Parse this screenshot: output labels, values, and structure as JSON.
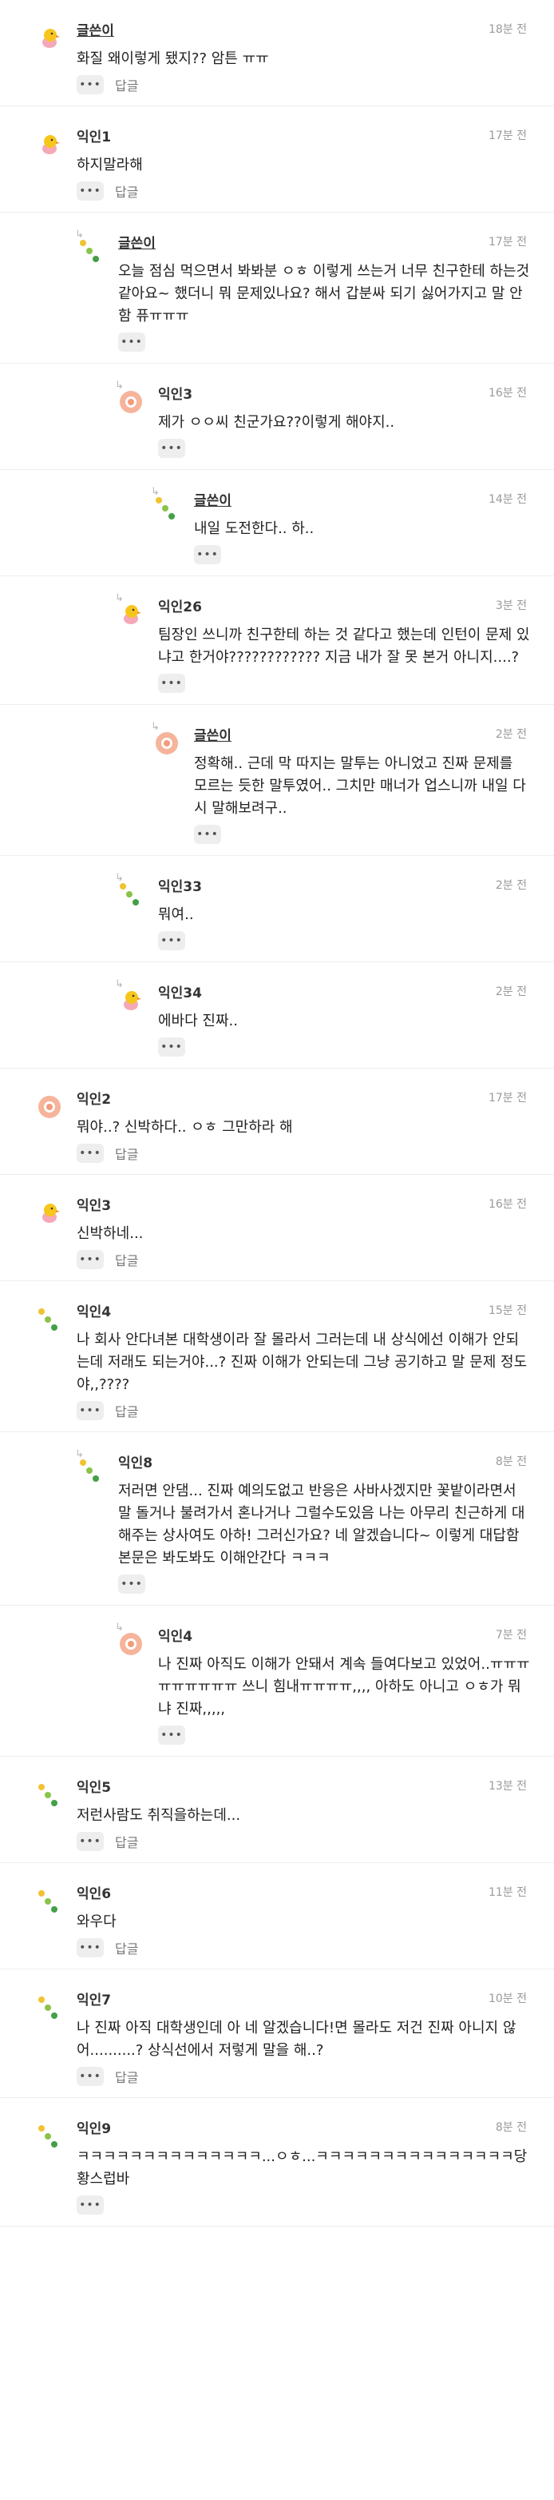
{
  "ui": {
    "more_label": "•••",
    "reply_label": "답글"
  },
  "comments": [
    {
      "author": "글쓴이",
      "writer": true,
      "time": "18분 전",
      "avatar": "chick",
      "depth": 0,
      "text": "화질 왜이렇게 됐지?? 암튼 ㅠㅠ",
      "show_reply": true
    },
    {
      "author": "익인1",
      "time": "17분 전",
      "avatar": "chick",
      "depth": 0,
      "text": "하지말라해",
      "show_reply": true
    },
    {
      "author": "글쓴이",
      "writer": true,
      "time": "17분 전",
      "avatar": "dots",
      "depth": 1,
      "text": "오늘 점심 먹으면서 봐봐분 ㅇㅎ 이렇게 쓰는거 너무 친구한테 하는것 같아요~ 했더니 뭐 문제있나요? 해서 갑분싸 되기 싫어가지고 말 안함 퓨ㅠㅠㅠ",
      "show_reply": false
    },
    {
      "author": "익인3",
      "time": "16분 전",
      "avatar": "ring",
      "depth": 2,
      "text": "제가 ㅇㅇ씨 친군가요??이렇게 해야지..",
      "show_reply": false
    },
    {
      "author": "글쓴이",
      "writer": true,
      "time": "14분 전",
      "avatar": "dots",
      "depth": 3,
      "text": "내일 도전한다.. 하..",
      "show_reply": false
    },
    {
      "author": "익인26",
      "time": "3분 전",
      "avatar": "chick",
      "depth": 2,
      "text": "팀장인 쓰니까 친구한테 하는 것 같다고 했는데 인턴이 문제 있냐고 한거야???????????? 지금 내가 잘 못 본거 아니지....?",
      "show_reply": false
    },
    {
      "author": "글쓴이",
      "writer": true,
      "time": "2분 전",
      "avatar": "ring",
      "depth": 3,
      "text": "정확해.. 근데 막 따지는 말투는 아니었고 진짜 문제를 모르는 듯한 말투였어.. 그치만 매너가 업스니까 내일 다시 말해보려구..",
      "show_reply": false
    },
    {
      "author": "익인33",
      "time": "2분 전",
      "avatar": "dots",
      "depth": 2,
      "text": "뭐여..",
      "show_reply": false
    },
    {
      "author": "익인34",
      "time": "2분 전",
      "avatar": "chick",
      "depth": 2,
      "text": "에바다 진짜..",
      "show_reply": false
    },
    {
      "author": "익인2",
      "time": "17분 전",
      "avatar": "ring",
      "depth": 0,
      "text": "뭐야..? 신박하다.. ㅇㅎ 그만하라 해",
      "show_reply": true
    },
    {
      "author": "익인3",
      "time": "16분 전",
      "avatar": "chick",
      "depth": 0,
      "text": "신박하네...",
      "show_reply": true
    },
    {
      "author": "익인4",
      "time": "15분 전",
      "avatar": "dots",
      "depth": 0,
      "text": "나 회사 안다녀본 대학생이라 잘 몰라서 그러는데 내 상식에선 이해가 안되는데 저래도 되는거야...? 진짜 이해가 안되는데 그냥 공기하고 말 문제 정도야,,????",
      "show_reply": true
    },
    {
      "author": "익인8",
      "time": "8분 전",
      "avatar": "dots",
      "depth": 1,
      "text": "저러면 안댐... 진짜 예의도없고 반응은 사바사겠지만 꽃밭이라면서 말 돌거나 불려가서 혼나거나 그럴수도있음 나는 아무리 친근하게 대해주는 상사여도 아하! 그러신가요? 네 알겠습니다~ 이렇게 대답함 본문은 봐도봐도 이해안간다 ㅋㅋㅋ",
      "show_reply": false
    },
    {
      "author": "익인4",
      "time": "7분 전",
      "avatar": "ring",
      "depth": 2,
      "text": "나 진짜 아직도 이해가 안돼서 계속 들여다보고 있었어..ㅠㅠㅠㅠㅠㅠㅠㅠㅠ 쓰니 힘내ㅠㅠㅠㅠ,,,, 아하도 아니고 ㅇㅎ가 뭐냐 진짜,,,,,",
      "show_reply": false
    },
    {
      "author": "익인5",
      "time": "13분 전",
      "avatar": "dots",
      "depth": 0,
      "text": "저런사람도 취직을하는데...",
      "show_reply": true
    },
    {
      "author": "익인6",
      "time": "11분 전",
      "avatar": "dots",
      "depth": 0,
      "text": "와우다",
      "show_reply": true
    },
    {
      "author": "익인7",
      "time": "10분 전",
      "avatar": "dots",
      "depth": 0,
      "text": "나 진짜 아직 대학생인데 아 네 알겠습니다!면 몰라도 저건 진짜 아니지 않어..........? 상식선에서 저렇게 말을 해..?",
      "show_reply": true
    },
    {
      "author": "익인9",
      "time": "8분 전",
      "avatar": "dots",
      "depth": 0,
      "text": "ㅋㅋㅋㅋㅋㅋㅋㅋㅋㅋㅋㅋㅋㅋ...ㅇㅎ...ㅋㅋㅋㅋㅋㅋㅋㅋㅋㅋㅋㅋㅋㅋㅋ당황스럽바",
      "show_reply": false
    }
  ]
}
